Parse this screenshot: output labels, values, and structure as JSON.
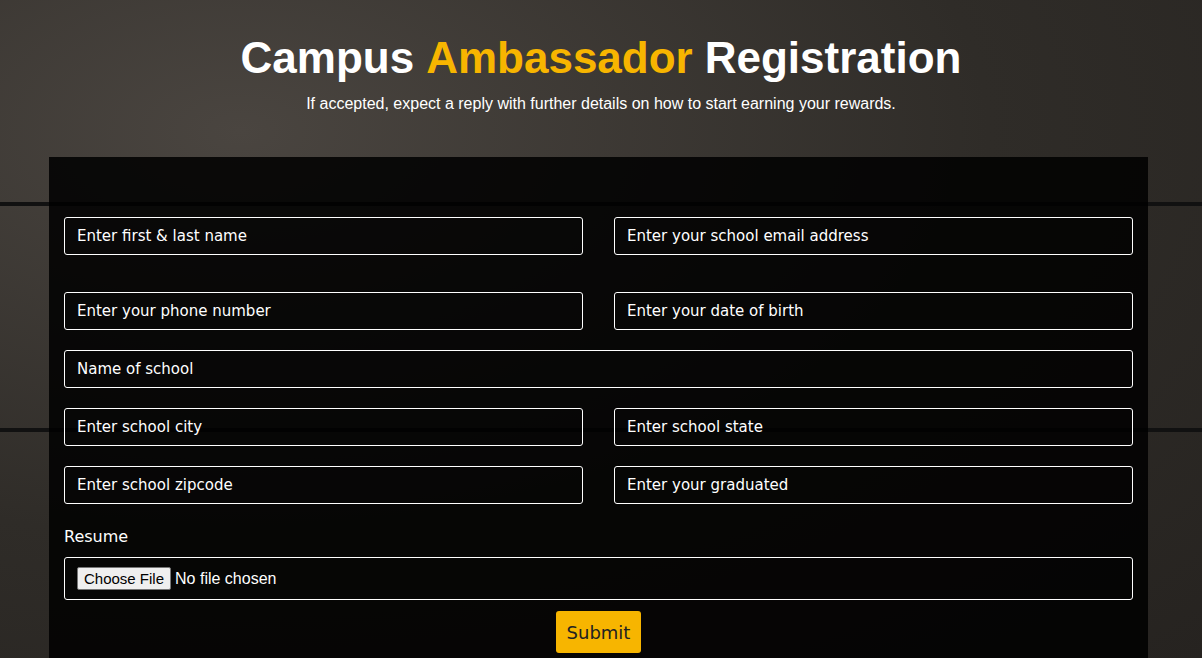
{
  "header": {
    "title": [
      {
        "text": "Campus",
        "highlight": false
      },
      {
        "text": "Ambassador",
        "highlight": true
      },
      {
        "text": "Registration",
        "highlight": false
      }
    ],
    "subtitle": "If accepted, expect a reply with further details on how to start earning your rewards."
  },
  "form": {
    "rows": [
      [
        {
          "placeholder": "Enter first & last name"
        },
        {
          "placeholder": "Enter your school email address"
        }
      ],
      [
        {
          "placeholder": "Enter your phone number"
        },
        {
          "placeholder": "Enter your date of birth"
        }
      ],
      [
        {
          "placeholder": "Name of school"
        }
      ],
      [
        {
          "placeholder": "Enter school city"
        },
        {
          "placeholder": "Enter school state"
        }
      ],
      [
        {
          "placeholder": "Enter school zipcode"
        },
        {
          "placeholder": "Enter your graduated"
        }
      ]
    ],
    "resume": {
      "label": "Resume",
      "button": "Choose File",
      "status": "No file chosen"
    },
    "submit": "Submit"
  }
}
